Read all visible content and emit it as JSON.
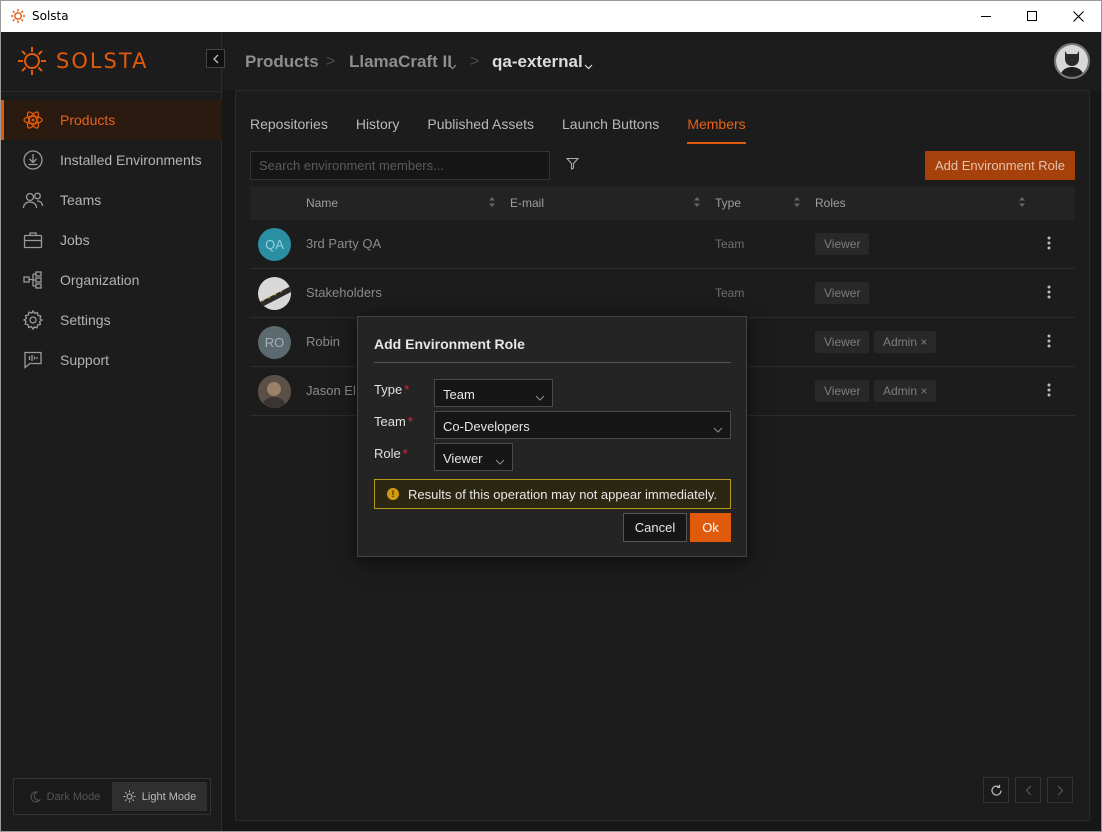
{
  "window": {
    "title": "Solsta",
    "minimize_icon": "minimize-icon",
    "maximize_icon": "maximize-icon",
    "close_icon": "close-icon"
  },
  "brand": {
    "logo_text": "SOLSTA",
    "accent_color": "#e05a0c"
  },
  "sidebar": {
    "items": [
      {
        "label": "Products",
        "icon": "atom-icon",
        "active": true
      },
      {
        "label": "Installed Environments",
        "icon": "download-circle-icon"
      },
      {
        "label": "Teams",
        "icon": "people-icon"
      },
      {
        "label": "Jobs",
        "icon": "briefcase-icon"
      },
      {
        "label": "Organization",
        "icon": "org-chart-icon"
      },
      {
        "label": "Settings",
        "icon": "gear-icon"
      },
      {
        "label": "Support",
        "icon": "support-chat-icon"
      }
    ],
    "mode": {
      "dark": "Dark Mode",
      "light": "Light Mode",
      "selected": "light"
    }
  },
  "breadcrumb": {
    "items": [
      {
        "label": "Products"
      },
      {
        "label": "LlamaCraft II"
      },
      {
        "label": "qa-external"
      }
    ]
  },
  "tabs": [
    {
      "label": "Repositories"
    },
    {
      "label": "History"
    },
    {
      "label": "Published Assets"
    },
    {
      "label": "Launch Buttons"
    },
    {
      "label": "Members",
      "active": true
    }
  ],
  "toolbar": {
    "search_placeholder": "Search environment members...",
    "add_role_label": "Add Environment Role"
  },
  "table": {
    "columns": [
      "Name",
      "E-mail",
      "Type",
      "Roles"
    ],
    "rows": [
      {
        "avatar": "QA",
        "avatar_color": "#2a8fa3",
        "name": "3rd Party QA",
        "email": "",
        "type": "Team",
        "roles": [
          "Viewer"
        ]
      },
      {
        "avatar": "",
        "avatar_color": "#d0d0d0",
        "name": "Stakeholders",
        "email": "",
        "type": "Team",
        "roles": [
          "Viewer"
        ]
      },
      {
        "avatar": "RO",
        "avatar_color": "#5b6a6e",
        "name": "Robin",
        "email": "",
        "type": "",
        "roles": [
          "Viewer",
          "Admin"
        ]
      },
      {
        "avatar": "",
        "avatar_color": "#6b5a4a",
        "name": "Jason El",
        "email": "",
        "type": "",
        "roles": [
          "Viewer",
          "Admin"
        ]
      }
    ]
  },
  "modal": {
    "title": "Add Environment Role",
    "fields": {
      "type": {
        "label": "Type",
        "value": "Team"
      },
      "team": {
        "label": "Team",
        "value": "Co-Developers"
      },
      "role": {
        "label": "Role",
        "value": "Viewer"
      }
    },
    "warning": "Results of this operation may not appear immediately.",
    "cancel_label": "Cancel",
    "ok_label": "Ok"
  }
}
